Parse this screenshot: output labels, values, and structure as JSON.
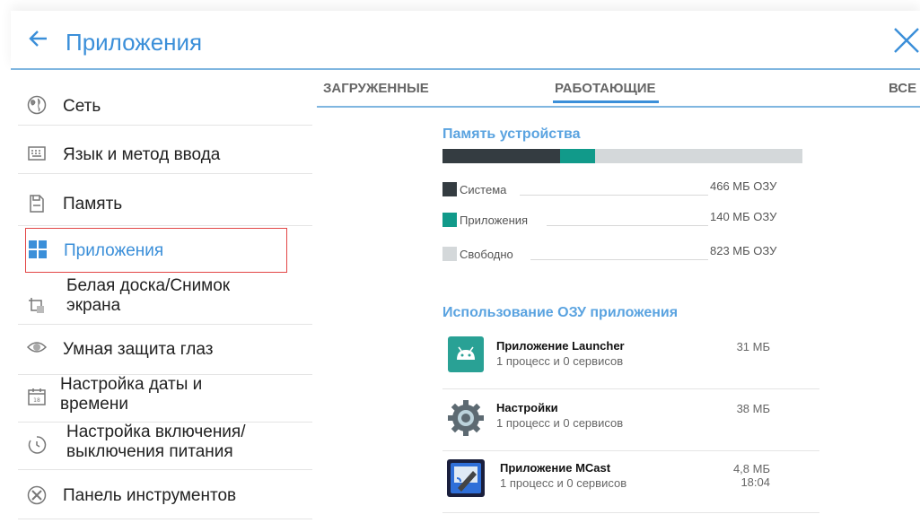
{
  "header": {
    "back_icon": "back-arrow-icon",
    "title": "Приложения",
    "close_icon": "close-icon",
    "accent": "#3b8fd9"
  },
  "sidebar": {
    "items": [
      {
        "label": "Сеть",
        "icon": "globe-icon"
      },
      {
        "label": "Язык и метод ввода",
        "icon": "keyboard-icon"
      },
      {
        "label": "Память",
        "icon": "sd-card-icon"
      },
      {
        "label": "Приложения",
        "icon": "apps-grid-icon",
        "active": true
      },
      {
        "label": "Белая доска/Снимок экрана",
        "label_line1": "Белая доска/Снимок",
        "label_line2": "экрана",
        "icon": "crop-icon"
      },
      {
        "label": "Умная защита глаз",
        "icon": "eye-icon"
      },
      {
        "label": "Настройка даты и времени",
        "label_line1": "Настройка даты и",
        "label_line2": "времени",
        "icon": "calendar-icon"
      },
      {
        "label": "Настройка включения/выключения питания",
        "label_line1": "Настройка включения/",
        "label_line2": "выключения питания",
        "icon": "power-timer-icon"
      },
      {
        "label": "Панель инструментов",
        "icon": "tools-icon"
      }
    ]
  },
  "tabs": [
    {
      "label": "ЗАГРУЖЕННЫЕ"
    },
    {
      "label": "РАБОТАЮЩИЕ",
      "selected": true
    },
    {
      "label": "ВСЕ"
    }
  ],
  "memory": {
    "title": "Память устройства",
    "total_mb": 1429,
    "legend": [
      {
        "label": "Система",
        "value": "466 МБ ОЗУ",
        "mb": 466,
        "color": "#343c41"
      },
      {
        "label": "Приложения",
        "value": "140 МБ ОЗУ",
        "mb": 140,
        "color": "#119a8a"
      },
      {
        "label": "Свободно",
        "value": "823 МБ ОЗУ",
        "mb": 823,
        "color": "#d4d8da"
      }
    ]
  },
  "ram_usage": {
    "title": "Использование ОЗУ приложения",
    "apps": [
      {
        "name": "Приложение Launcher",
        "detail": "1 процесс и 0 сервисов",
        "size": "31 МБ",
        "time": "",
        "icon": "android-icon"
      },
      {
        "name": "Настройки",
        "detail": "1 процесс и 0 сервисов",
        "size": "38 МБ",
        "time": "",
        "icon": "settings-gear-icon"
      },
      {
        "name": "Приложение MCast",
        "detail": "1 процесс и 0 сервисов",
        "size": "4,8 МБ",
        "time": "18:04",
        "icon": "mcast-icon"
      }
    ]
  }
}
